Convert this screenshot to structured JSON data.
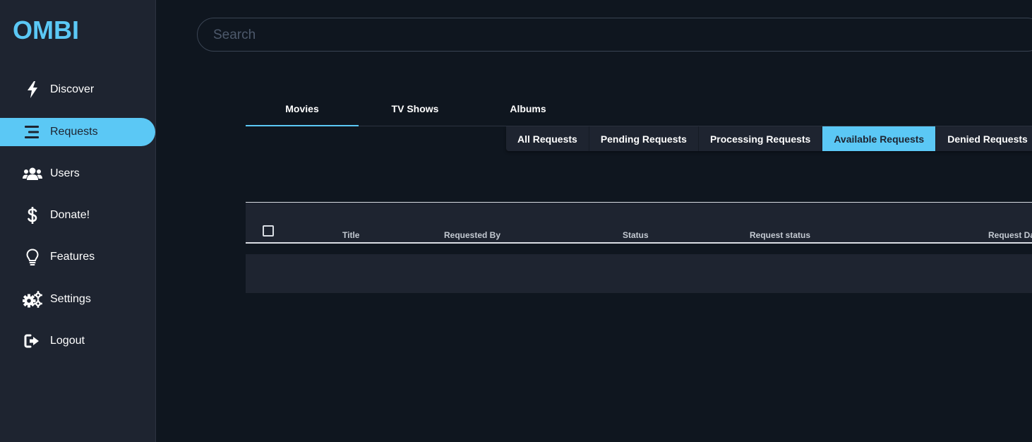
{
  "app": {
    "logo": "OMBI"
  },
  "sidebar": {
    "items": [
      {
        "label": "Discover",
        "icon": "bolt-icon"
      },
      {
        "label": "Requests",
        "icon": "list-icon",
        "active": true
      },
      {
        "label": "Users",
        "icon": "users-icon"
      },
      {
        "label": "Donate!",
        "icon": "dollar-icon"
      },
      {
        "label": "Features",
        "icon": "lightbulb-icon"
      },
      {
        "label": "Settings",
        "icon": "gears-icon"
      },
      {
        "label": "Logout",
        "icon": "logout-icon"
      }
    ]
  },
  "search": {
    "placeholder": "Search",
    "value": ""
  },
  "tabs": [
    {
      "label": "Movies",
      "active": true
    },
    {
      "label": "TV Shows"
    },
    {
      "label": "Albums"
    }
  ],
  "filters": [
    {
      "label": "All Requests"
    },
    {
      "label": "Pending Requests"
    },
    {
      "label": "Processing Requests"
    },
    {
      "label": "Available Requests",
      "active": true
    },
    {
      "label": "Denied Requests"
    }
  ],
  "table": {
    "columns": [
      "Title",
      "Requested By",
      "Status",
      "Request status",
      "Request Date"
    ]
  },
  "colors": {
    "accent": "#5bc8f5",
    "background": "#0f161f",
    "panel": "#1e2430"
  }
}
